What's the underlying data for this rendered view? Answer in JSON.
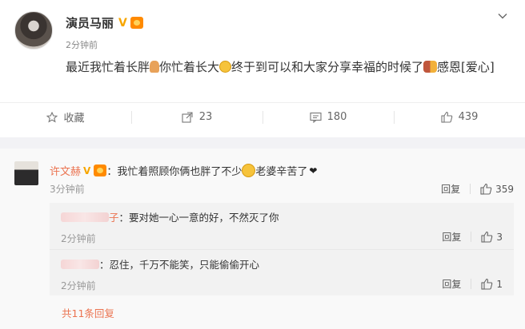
{
  "post": {
    "author": "演员马丽",
    "time": "2分钟前",
    "text_part1": "最近我忙着长胖",
    "text_part2": "你忙着长大",
    "text_part3": "终于到可以和大家分享幸福的时候了",
    "text_part4": "感恩[爱心]",
    "actions": {
      "favorite": "收藏",
      "repost": "23",
      "comment": "180",
      "like": "439"
    }
  },
  "comments": [
    {
      "user": "许文赫",
      "text_a": "：我忙着照顾你俩也胖了不少",
      "text_b": " 老婆辛苦了",
      "time": "3分钟前",
      "reply_label": "回复",
      "likes": "359",
      "sub_replies": [
        {
          "user_suffix": "子",
          "text": "：要对她一心一意的好，不然灭了你",
          "time": "2分钟前",
          "reply_label": "回复",
          "likes": "3"
        },
        {
          "user_suffix": "",
          "text": "：忍住，千万不能笑，只能偷偷开心",
          "time": "2分钟前",
          "reply_label": "回复",
          "likes": "1"
        }
      ]
    }
  ],
  "more_replies": "共11条回复",
  "icons": [
    "chevron-down-icon",
    "verified-v-icon",
    "medal-icon",
    "star-icon",
    "repost-icon",
    "comment-icon",
    "thumbs-up-icon"
  ]
}
